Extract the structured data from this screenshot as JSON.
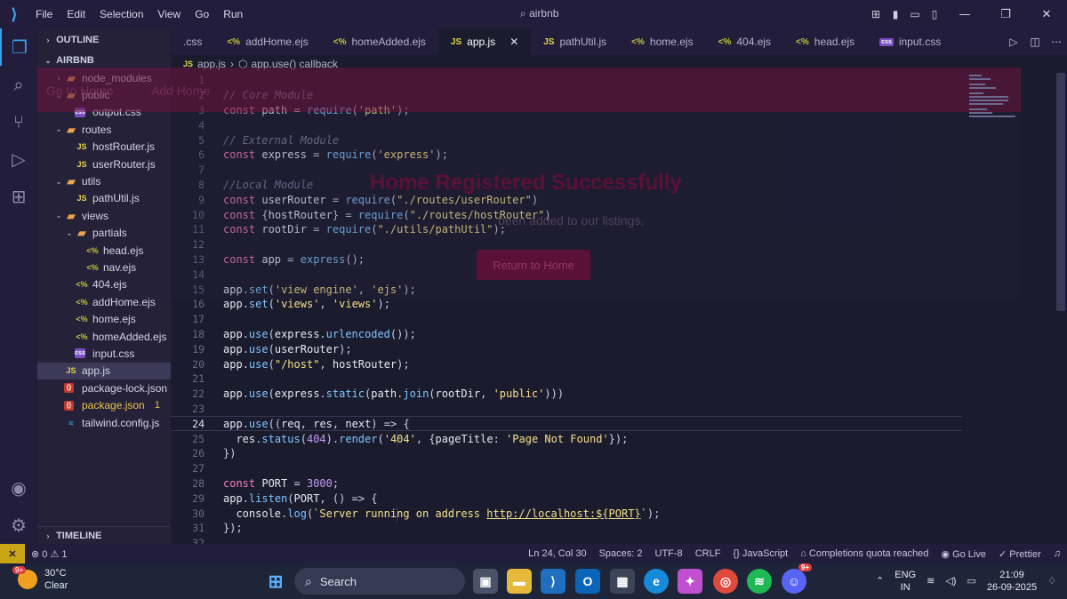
{
  "titlebar": {
    "menu": [
      "File",
      "Edit",
      "Selection",
      "View",
      "Go",
      "Run"
    ],
    "title": "airbnb"
  },
  "sidebar": {
    "outline_label": "OUTLINE",
    "project_label": "AIRBNB",
    "timeline_label": "TIMELINE",
    "tree": [
      {
        "name": "node_modules",
        "type": "folder",
        "depth": 1,
        "open": false
      },
      {
        "name": "public",
        "type": "folder",
        "depth": 1,
        "open": true
      },
      {
        "name": "output.css",
        "type": "css",
        "depth": 2
      },
      {
        "name": "routes",
        "type": "folder",
        "depth": 1,
        "open": true
      },
      {
        "name": "hostRouter.js",
        "type": "js",
        "depth": 2
      },
      {
        "name": "userRouter.js",
        "type": "js",
        "depth": 2
      },
      {
        "name": "utils",
        "type": "folder",
        "depth": 1,
        "open": true
      },
      {
        "name": "pathUtil.js",
        "type": "js",
        "depth": 2
      },
      {
        "name": "views",
        "type": "folder",
        "depth": 1,
        "open": true
      },
      {
        "name": "partials",
        "type": "folder",
        "depth": 2,
        "open": true
      },
      {
        "name": "head.ejs",
        "type": "ejs",
        "depth": 3
      },
      {
        "name": "nav.ejs",
        "type": "ejs",
        "depth": 3
      },
      {
        "name": "404.ejs",
        "type": "ejs",
        "depth": 2
      },
      {
        "name": "addHome.ejs",
        "type": "ejs",
        "depth": 2
      },
      {
        "name": "home.ejs",
        "type": "ejs",
        "depth": 2
      },
      {
        "name": "homeAdded.ejs",
        "type": "ejs",
        "depth": 2
      },
      {
        "name": "input.css",
        "type": "css",
        "depth": 2
      },
      {
        "name": "app.js",
        "type": "js",
        "depth": 1,
        "selected": true
      },
      {
        "name": "package-lock.json",
        "type": "json",
        "depth": 1
      },
      {
        "name": "package.json",
        "type": "json",
        "depth": 1,
        "badge": "1"
      },
      {
        "name": "tailwind.config.js",
        "type": "tw",
        "depth": 1
      }
    ]
  },
  "tabs": [
    {
      "label": ".css",
      "icon": ""
    },
    {
      "label": "addHome.ejs",
      "icon": "<%"
    },
    {
      "label": "homeAdded.ejs",
      "icon": "<%"
    },
    {
      "label": "app.js",
      "icon": "JS",
      "active": true
    },
    {
      "label": "pathUtil.js",
      "icon": "JS"
    },
    {
      "label": "home.ejs",
      "icon": "<%"
    },
    {
      "label": "404.ejs",
      "icon": "<%"
    },
    {
      "label": "head.ejs",
      "icon": "<%"
    },
    {
      "label": "input.css",
      "icon": "css"
    }
  ],
  "breadcrumb": {
    "file": "app.js",
    "symbol": "app.use() callback"
  },
  "editor": {
    "current_line": 24,
    "lines": [
      "",
      "// Core Module",
      "const path = require('path');",
      "",
      "// External Module",
      "const express = require('express');",
      "",
      "//Local Module",
      "const userRouter = require(\"./routes/userRouter\")",
      "const {hostRouter} = require(\"./routes/hostRouter\")",
      "const rootDir = require(\"./utils/pathUtil\");",
      "",
      "const app = express();",
      "",
      "app.set('view engine', 'ejs');",
      "app.set('views', 'views');",
      "",
      "app.use(express.urlencoded());",
      "app.use(userRouter);",
      "app.use(\"/host\", hostRouter);",
      "",
      "app.use(express.static(path.join(rootDir, 'public')))",
      "",
      "app.use((req, res, next) => {",
      "  res.status(404).render('404', {pageTitle: 'Page Not Found'});",
      "})",
      "",
      "const PORT = 3000;",
      "app.listen(PORT, () => {",
      "  console.log(`Server running on address http://localhost:${PORT}`);",
      "});",
      ""
    ]
  },
  "ghost": {
    "nav_home": "Go to Home",
    "nav_add": "Add Home",
    "heading": "Home Registered Successfully",
    "text": "been added to our listings.",
    "button": "Return to Home"
  },
  "statusbar": {
    "errors": "0",
    "warnings": "1",
    "position": "Ln 24, Col 30",
    "spaces": "Spaces: 2",
    "encoding": "UTF-8",
    "eol": "CRLF",
    "language": "JavaScript",
    "copilot": "Completions quota reached",
    "golive": "Go Live",
    "prettier": "Prettier"
  },
  "taskbar": {
    "weather_temp": "30°C",
    "weather_desc": "Clear",
    "weather_badge": "9+",
    "search": "Search",
    "lang_top": "ENG",
    "lang_bottom": "IN",
    "time": "21:09",
    "date": "26-09-2025",
    "discord_badge": "9+"
  },
  "colors": {
    "accent": "#3aa0f0",
    "editor_bg": "#1b1b2e",
    "sidebar_bg": "#252139",
    "keyword": "#f77fbe",
    "string": "#f5e08a"
  }
}
